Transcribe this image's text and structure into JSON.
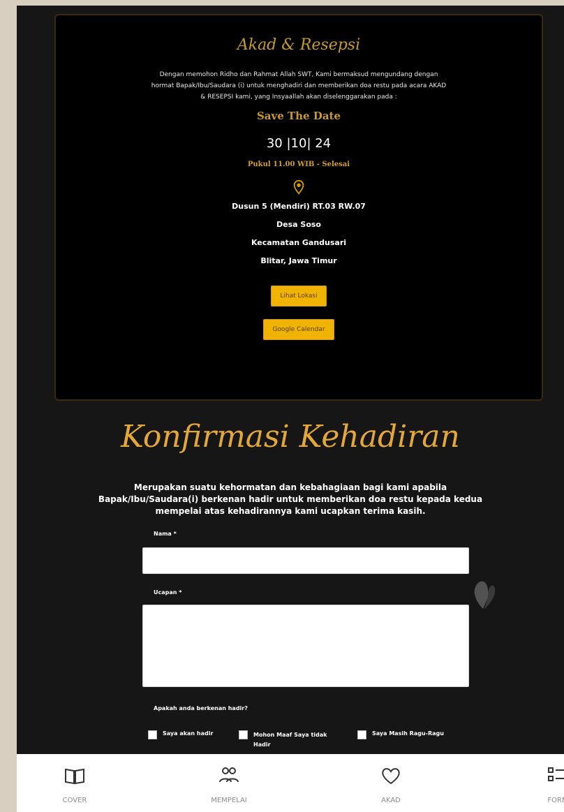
{
  "akad": {
    "title": "Akad & Resepsi",
    "intro": "Dengan memohon Ridho dan Rahmat Allah SWT, Kami bermaksud mengundang dengan hormat Bapak/Ibu/Saudara (i) untuk menghadiri dan memberikan doa restu pada acara AKAD & RESEPSI kami, yang Insyaallah akan diselenggarakan pada :",
    "save_the_date": "Save The Date",
    "date": "30 |10| 24",
    "time": "Pukul 11.00 WIB - Selesai",
    "location_icon": "location-pin-icon",
    "address": [
      "Dusun 5 (Mendiri) RT.03 RW.07",
      "Desa Soso",
      "Kecamatan Gandusari",
      "Blitar, Jawa Timur"
    ],
    "btn_location": "Lihat Lokasi",
    "btn_calendar": "Google Calendar"
  },
  "rsvp": {
    "title": "Konfirmasi Kehadiran",
    "description": "Merupakan suatu kehormatan dan kebahagiaan bagi kami apabila Bapak/Ibu/Saudara(i) berkenan hadir untuk memberikan doa restu kepada kedua mempelai atas kehadirannya kami ucapkan terima kasih.",
    "name_label": "Nama *",
    "name_value": "",
    "message_label": "Ucapan *",
    "message_value": "",
    "attend_label": "Apakah anda berkenan hadir?",
    "options": [
      "Saya akan hadir",
      "Mohon Maaf Saya tidak Hadir",
      "Saya Masih Ragu-Ragu"
    ]
  },
  "nav": {
    "items": [
      {
        "label": "COVER",
        "icon": "book-icon"
      },
      {
        "label": "MEMPELAI",
        "icon": "people-icon"
      },
      {
        "label": "AKAD",
        "icon": "heart-icon"
      },
      {
        "label": "FORM",
        "icon": "checklist-icon"
      }
    ]
  },
  "colors": {
    "gold": "#e3a73a",
    "button": "#f0b400",
    "background": "#161616"
  }
}
